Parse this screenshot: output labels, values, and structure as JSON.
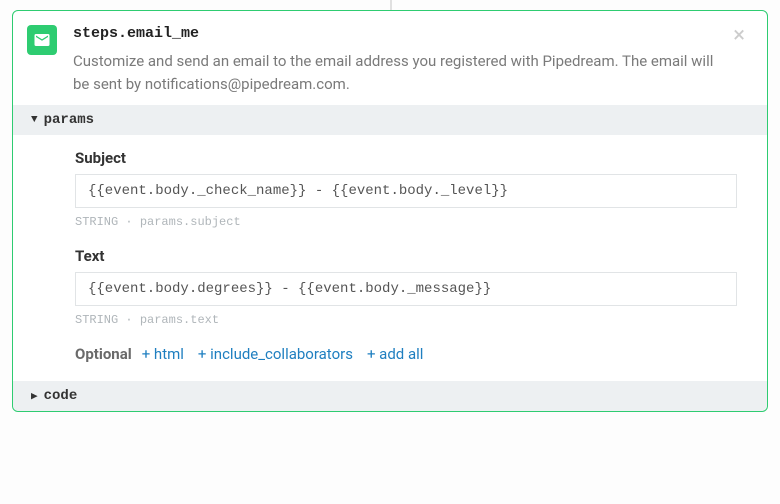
{
  "step": {
    "name": "steps.email_me",
    "description": "Customize and send an email to the email address you registered with Pipedream. The email will be sent by notifications@pipedream.com."
  },
  "sections": {
    "params_label": "params",
    "code_label": "code"
  },
  "params": {
    "subject": {
      "label": "Subject",
      "value": "{{event.body._check_name}} - {{event.body._level}}",
      "type": "STRING",
      "path": "params.subject"
    },
    "text": {
      "label": "Text",
      "value": "{{event.body.degrees}} - {{event.body._message}}",
      "type": "STRING",
      "path": "params.text"
    }
  },
  "optional": {
    "label": "Optional",
    "items": [
      "+ html",
      "+ include_collaborators",
      "+ add all"
    ]
  }
}
